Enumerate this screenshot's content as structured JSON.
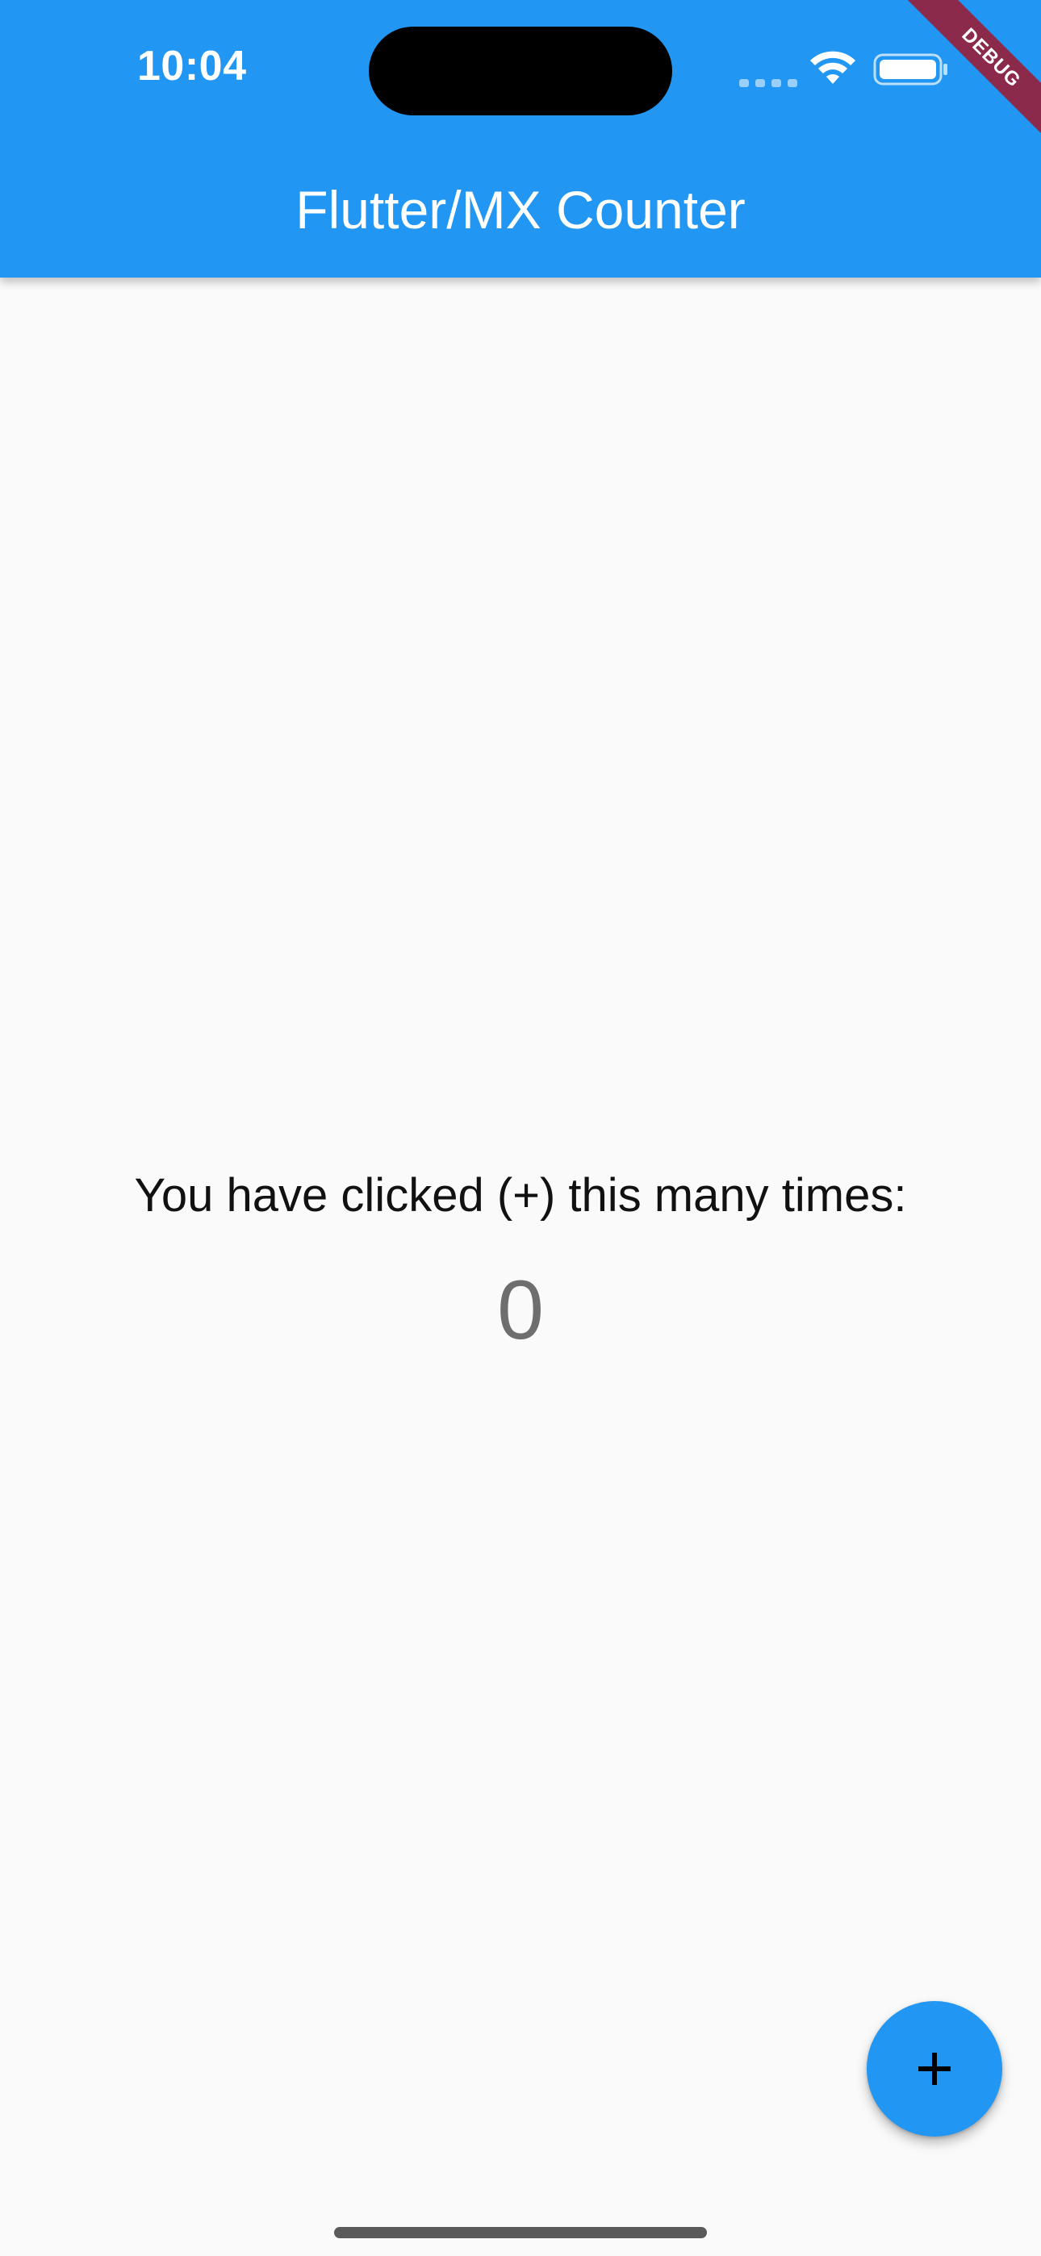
{
  "status_bar": {
    "time": "10:04",
    "icons": [
      "cellular-signal-icon",
      "wifi-icon",
      "battery-icon"
    ]
  },
  "debug_banner": {
    "label": "DEBUG"
  },
  "app_bar": {
    "title": "Flutter/MX Counter"
  },
  "main": {
    "prompt": "You have clicked (+) this many times:",
    "count": "0"
  },
  "fab": {
    "icon": "plus-icon",
    "label": "+"
  },
  "colors": {
    "primary": "#2196f3",
    "background": "#fafafa",
    "debug_ribbon": "#8b2a4a",
    "counter_text": "#6e6e6e"
  }
}
